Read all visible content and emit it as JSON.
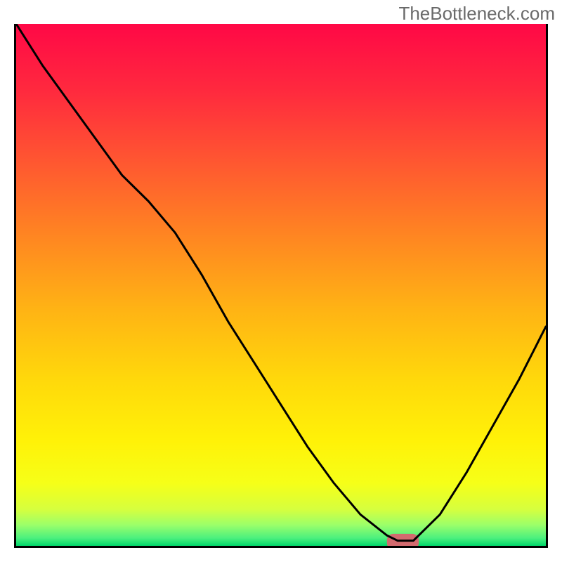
{
  "watermark": "TheBottleneck.com",
  "chart_data": {
    "type": "line",
    "title": "",
    "xlabel": "",
    "ylabel": "",
    "xlim": [
      0,
      100
    ],
    "ylim": [
      0,
      100
    ],
    "series": [
      {
        "name": "curve",
        "x": [
          0,
          5,
          10,
          15,
          20,
          25,
          30,
          35,
          40,
          45,
          50,
          55,
          60,
          65,
          70,
          72,
          75,
          80,
          85,
          90,
          95,
          100
        ],
        "values": [
          100,
          92,
          85,
          78,
          71,
          66,
          60,
          52,
          43,
          35,
          27,
          19,
          12,
          6,
          2,
          1,
          1,
          6,
          14,
          23,
          32,
          42
        ]
      }
    ],
    "background_gradient": {
      "stops": [
        {
          "offset": 0,
          "color": "#ff0846"
        },
        {
          "offset": 0.13,
          "color": "#ff2a3e"
        },
        {
          "offset": 0.28,
          "color": "#ff5c2f"
        },
        {
          "offset": 0.42,
          "color": "#ff8a20"
        },
        {
          "offset": 0.55,
          "color": "#ffb414"
        },
        {
          "offset": 0.68,
          "color": "#ffd80b"
        },
        {
          "offset": 0.8,
          "color": "#fff208"
        },
        {
          "offset": 0.88,
          "color": "#f6ff18"
        },
        {
          "offset": 0.93,
          "color": "#d6ff3e"
        },
        {
          "offset": 0.96,
          "color": "#9bff6a"
        },
        {
          "offset": 0.985,
          "color": "#4cf07e"
        },
        {
          "offset": 1.0,
          "color": "#00d66a"
        }
      ]
    },
    "marker": {
      "x": 73,
      "y": 0.8,
      "width": 6,
      "height": 3,
      "color": "#d36b6f"
    }
  }
}
